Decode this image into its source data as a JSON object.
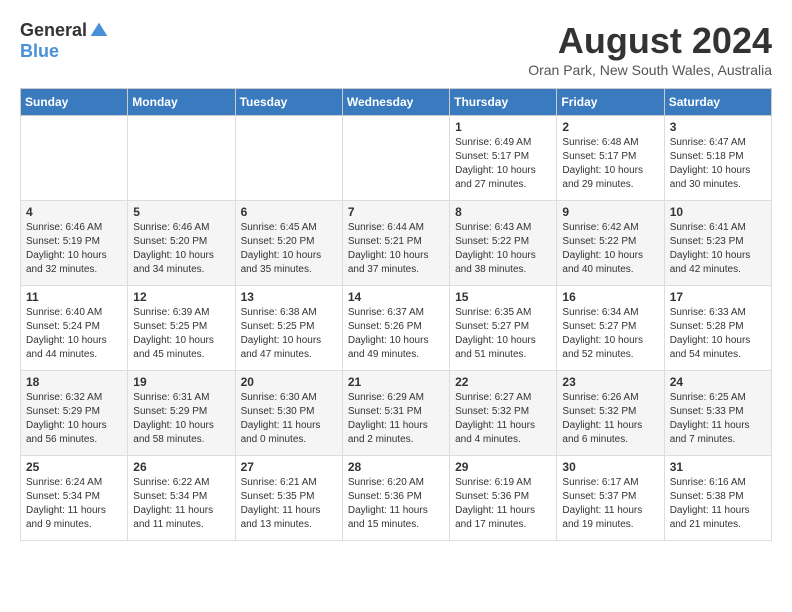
{
  "logo": {
    "general": "General",
    "blue": "Blue"
  },
  "title": {
    "month": "August 2024",
    "location": "Oran Park, New South Wales, Australia"
  },
  "headers": [
    "Sunday",
    "Monday",
    "Tuesday",
    "Wednesday",
    "Thursday",
    "Friday",
    "Saturday"
  ],
  "weeks": [
    [
      {
        "day": "",
        "info": ""
      },
      {
        "day": "",
        "info": ""
      },
      {
        "day": "",
        "info": ""
      },
      {
        "day": "",
        "info": ""
      },
      {
        "day": "1",
        "sunrise": "6:49 AM",
        "sunset": "5:17 PM",
        "daylight": "10 hours and 27 minutes."
      },
      {
        "day": "2",
        "sunrise": "6:48 AM",
        "sunset": "5:17 PM",
        "daylight": "10 hours and 29 minutes."
      },
      {
        "day": "3",
        "sunrise": "6:47 AM",
        "sunset": "5:18 PM",
        "daylight": "10 hours and 30 minutes."
      }
    ],
    [
      {
        "day": "4",
        "sunrise": "6:46 AM",
        "sunset": "5:19 PM",
        "daylight": "10 hours and 32 minutes."
      },
      {
        "day": "5",
        "sunrise": "6:46 AM",
        "sunset": "5:20 PM",
        "daylight": "10 hours and 34 minutes."
      },
      {
        "day": "6",
        "sunrise": "6:45 AM",
        "sunset": "5:20 PM",
        "daylight": "10 hours and 35 minutes."
      },
      {
        "day": "7",
        "sunrise": "6:44 AM",
        "sunset": "5:21 PM",
        "daylight": "10 hours and 37 minutes."
      },
      {
        "day": "8",
        "sunrise": "6:43 AM",
        "sunset": "5:22 PM",
        "daylight": "10 hours and 38 minutes."
      },
      {
        "day": "9",
        "sunrise": "6:42 AM",
        "sunset": "5:22 PM",
        "daylight": "10 hours and 40 minutes."
      },
      {
        "day": "10",
        "sunrise": "6:41 AM",
        "sunset": "5:23 PM",
        "daylight": "10 hours and 42 minutes."
      }
    ],
    [
      {
        "day": "11",
        "sunrise": "6:40 AM",
        "sunset": "5:24 PM",
        "daylight": "10 hours and 44 minutes."
      },
      {
        "day": "12",
        "sunrise": "6:39 AM",
        "sunset": "5:25 PM",
        "daylight": "10 hours and 45 minutes."
      },
      {
        "day": "13",
        "sunrise": "6:38 AM",
        "sunset": "5:25 PM",
        "daylight": "10 hours and 47 minutes."
      },
      {
        "day": "14",
        "sunrise": "6:37 AM",
        "sunset": "5:26 PM",
        "daylight": "10 hours and 49 minutes."
      },
      {
        "day": "15",
        "sunrise": "6:35 AM",
        "sunset": "5:27 PM",
        "daylight": "10 hours and 51 minutes."
      },
      {
        "day": "16",
        "sunrise": "6:34 AM",
        "sunset": "5:27 PM",
        "daylight": "10 hours and 52 minutes."
      },
      {
        "day": "17",
        "sunrise": "6:33 AM",
        "sunset": "5:28 PM",
        "daylight": "10 hours and 54 minutes."
      }
    ],
    [
      {
        "day": "18",
        "sunrise": "6:32 AM",
        "sunset": "5:29 PM",
        "daylight": "10 hours and 56 minutes."
      },
      {
        "day": "19",
        "sunrise": "6:31 AM",
        "sunset": "5:29 PM",
        "daylight": "10 hours and 58 minutes."
      },
      {
        "day": "20",
        "sunrise": "6:30 AM",
        "sunset": "5:30 PM",
        "daylight": "11 hours and 0 minutes."
      },
      {
        "day": "21",
        "sunrise": "6:29 AM",
        "sunset": "5:31 PM",
        "daylight": "11 hours and 2 minutes."
      },
      {
        "day": "22",
        "sunrise": "6:27 AM",
        "sunset": "5:32 PM",
        "daylight": "11 hours and 4 minutes."
      },
      {
        "day": "23",
        "sunrise": "6:26 AM",
        "sunset": "5:32 PM",
        "daylight": "11 hours and 6 minutes."
      },
      {
        "day": "24",
        "sunrise": "6:25 AM",
        "sunset": "5:33 PM",
        "daylight": "11 hours and 7 minutes."
      }
    ],
    [
      {
        "day": "25",
        "sunrise": "6:24 AM",
        "sunset": "5:34 PM",
        "daylight": "11 hours and 9 minutes."
      },
      {
        "day": "26",
        "sunrise": "6:22 AM",
        "sunset": "5:34 PM",
        "daylight": "11 hours and 11 minutes."
      },
      {
        "day": "27",
        "sunrise": "6:21 AM",
        "sunset": "5:35 PM",
        "daylight": "11 hours and 13 minutes."
      },
      {
        "day": "28",
        "sunrise": "6:20 AM",
        "sunset": "5:36 PM",
        "daylight": "11 hours and 15 minutes."
      },
      {
        "day": "29",
        "sunrise": "6:19 AM",
        "sunset": "5:36 PM",
        "daylight": "11 hours and 17 minutes."
      },
      {
        "day": "30",
        "sunrise": "6:17 AM",
        "sunset": "5:37 PM",
        "daylight": "11 hours and 19 minutes."
      },
      {
        "day": "31",
        "sunrise": "6:16 AM",
        "sunset": "5:38 PM",
        "daylight": "11 hours and 21 minutes."
      }
    ]
  ]
}
